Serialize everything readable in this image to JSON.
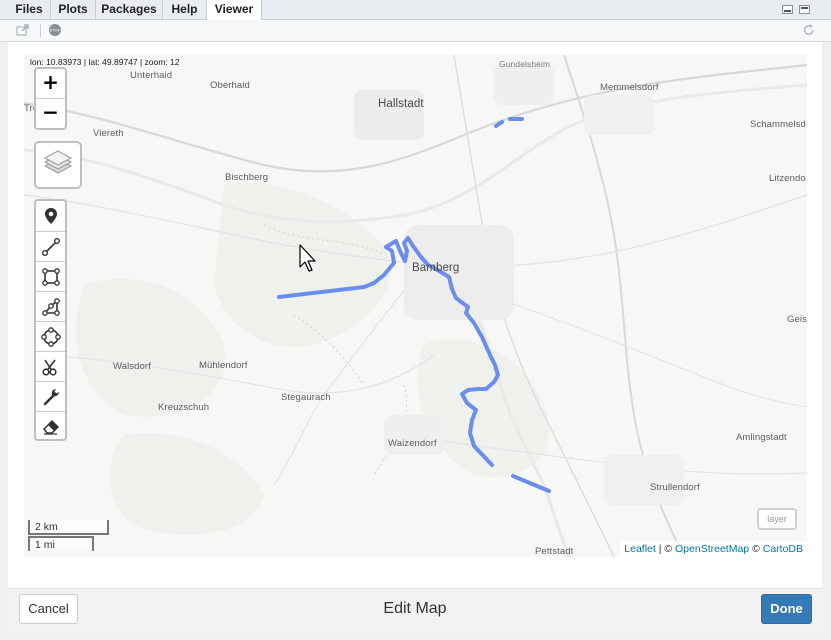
{
  "pane": {
    "tabs": [
      {
        "label": "Files"
      },
      {
        "label": "Plots"
      },
      {
        "label": "Packages"
      },
      {
        "label": "Help"
      },
      {
        "label": "Viewer"
      }
    ],
    "active_tab": "Viewer"
  },
  "toolbar": {
    "icons": [
      "popout-icon",
      "stop-icon",
      "refresh-icon"
    ]
  },
  "map": {
    "coord_readout": "lon: 10.83973 | lat: 49.89747 | zoom: 12",
    "zoom_in_label": "+",
    "zoom_out_label": "−",
    "draw_tools": [
      "marker-icon",
      "polyline-icon",
      "rectangle-icon",
      "polygon-icon",
      "circle-marker-icon",
      "cut-icon",
      "edit-icon",
      "erase-icon"
    ],
    "places": [
      {
        "name": "Unterhaid"
      },
      {
        "name": "Gundelsheim"
      },
      {
        "name": "Oberhaid"
      },
      {
        "name": "Hallstadt"
      },
      {
        "name": "Memmelsdorf"
      },
      {
        "name": "Schammelsd"
      },
      {
        "name": "Trosdorf"
      },
      {
        "name": "Viereth"
      },
      {
        "name": "Bischberg"
      },
      {
        "name": "Litzendo"
      },
      {
        "name": "Bamberg"
      },
      {
        "name": "Geis"
      },
      {
        "name": "Walsdorf"
      },
      {
        "name": "Mühlendorf"
      },
      {
        "name": "Kreuzschuh"
      },
      {
        "name": "Stegaurach"
      },
      {
        "name": "Waizendorf"
      },
      {
        "name": "Amlingstadt"
      },
      {
        "name": "Strullendorf"
      },
      {
        "name": "Pettstadt"
      }
    ],
    "scale_km": "2 km",
    "scale_mi": "1 mi",
    "attribution": {
      "leaflet": "Leaflet",
      "sep1": " | © ",
      "osm": "OpenStreetMap",
      "sep2": " © ",
      "carto": "CartoDB"
    },
    "layer_box_label": "layer",
    "route_color": "#6b8def"
  },
  "dialog": {
    "title": "Edit Map",
    "cancel_label": "Cancel",
    "done_label": "Done"
  }
}
